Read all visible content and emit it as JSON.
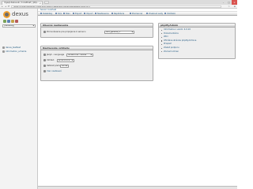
{
  "browser": {
    "tab_title": "mysql.dexus.sk / localhost | php...",
    "url": "https://mysql.dexus.sk/ index.php?token=4abe52e7f6bd6d3e9d4e0b1c2b93f5c3",
    "close_glyph": "×",
    "star_glyph": "☆",
    "menu_glyph": "≡",
    "back_glyph": "←",
    "forward_glyph": "→",
    "reload_glyph": "⟳"
  },
  "nav": {
    "logo_text": "dexus",
    "db_select": "(Databázy)",
    "databases": [
      {
        "name": "dexus_testtest"
      },
      {
        "name": "information_schema"
      }
    ]
  },
  "serverbar": {
    "text": "Server: localhost"
  },
  "topmenu": {
    "items": [
      {
        "label": "Databázy"
      },
      {
        "label": "SQL"
      },
      {
        "label": "Stav"
      },
      {
        "label": "Export"
      },
      {
        "label": "Import"
      },
      {
        "label": "Nastavenia"
      },
      {
        "label": "Replikácia"
      },
      {
        "label": "Premenné"
      },
      {
        "label": "Znakové sady"
      },
      {
        "label": "Úložiská"
      }
    ]
  },
  "general": {
    "title": "Obecné nastavenia",
    "collation_label": "Porovnávanie pre pripojenie k serveru",
    "collation_value": "utf8_general_ci"
  },
  "appearance": {
    "title": "Nastavenie vzhľadu",
    "language_label": "Jazyk - Language",
    "language_value": "Slovenčina - Slovak",
    "theme_label": "Vzhľad:",
    "theme_value": "pmahomme",
    "fontsize_label": "Veľkosť písma:",
    "fontsize_value": "82%",
    "more_settings": "Viac nastavení"
  },
  "info": {
    "title": "phpMyAdmin",
    "items": [
      "Informácie o verzii: 4.0.10",
      "Dokumentácia",
      "Wiki",
      "Oficiálna stránka phpMyAdmina",
      "Prispieť",
      "Získať podporu",
      "Zoznam zmien"
    ]
  },
  "console": {
    "label": ""
  },
  "colors": {
    "link": "#235a81",
    "logo_orange": "#f0a030",
    "panel_bg": "#eeeeee"
  },
  "icons": [
    "back-icon",
    "forward-icon",
    "reload-icon",
    "star-icon",
    "menu-icon",
    "database-icon",
    "home-icon",
    "settings-icon",
    "exit-icon"
  ]
}
